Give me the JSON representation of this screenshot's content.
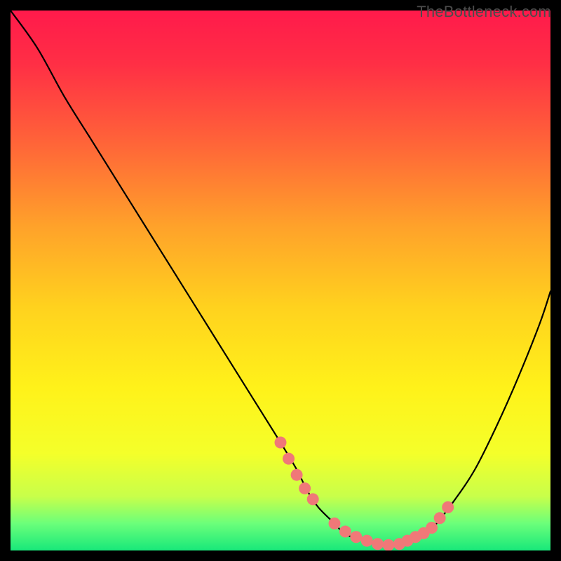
{
  "watermark": "TheBottleneck.com",
  "chart_data": {
    "type": "line",
    "title": "",
    "xlabel": "",
    "ylabel": "",
    "xlim": [
      0,
      100
    ],
    "ylim": [
      0,
      100
    ],
    "series": [
      {
        "name": "bottleneck-curve",
        "x": [
          0,
          5,
          10,
          15,
          20,
          25,
          30,
          35,
          40,
          45,
          50,
          53,
          55,
          57,
          60,
          62,
          65,
          68,
          70,
          72,
          75,
          78,
          82,
          86,
          90,
          94,
          98,
          100
        ],
        "y": [
          100,
          93,
          84,
          76,
          68,
          60,
          52,
          44,
          36,
          28,
          20,
          15,
          11,
          8,
          5,
          3,
          2,
          1,
          1,
          1,
          2,
          4,
          9,
          15,
          23,
          32,
          42,
          48
        ]
      }
    ],
    "markers": {
      "name": "highlight-dots",
      "x": [
        50,
        51.5,
        53,
        54.5,
        56,
        60,
        62,
        64,
        66,
        68,
        70,
        72,
        73.5,
        75,
        76.5,
        78,
        79.5,
        81
      ],
      "y": [
        20,
        17,
        14,
        11.5,
        9.5,
        5,
        3.5,
        2.5,
        1.8,
        1.2,
        1,
        1.2,
        1.8,
        2.5,
        3.2,
        4.2,
        6,
        8
      ]
    },
    "gradient_stops": [
      {
        "offset": 0.0,
        "color": "#ff1a4b"
      },
      {
        "offset": 0.1,
        "color": "#ff2f45"
      },
      {
        "offset": 0.25,
        "color": "#ff6638"
      },
      {
        "offset": 0.4,
        "color": "#ffa22a"
      },
      {
        "offset": 0.55,
        "color": "#ffd21e"
      },
      {
        "offset": 0.7,
        "color": "#fff21a"
      },
      {
        "offset": 0.82,
        "color": "#f4ff2a"
      },
      {
        "offset": 0.9,
        "color": "#c8ff4a"
      },
      {
        "offset": 0.95,
        "color": "#6bff7a"
      },
      {
        "offset": 1.0,
        "color": "#18e87a"
      }
    ],
    "marker_color": "#f07878",
    "line_color": "#000000"
  }
}
